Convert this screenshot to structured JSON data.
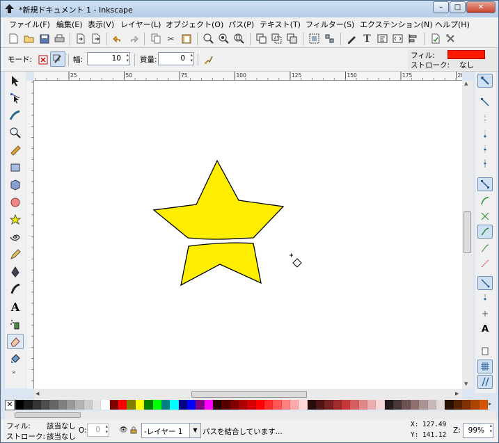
{
  "window": {
    "title": "*新規ドキュメント 1 - Inkscape",
    "minimize": "–",
    "maximize": "□",
    "close": "✕"
  },
  "menu": [
    "ファイル(F)",
    "編集(E)",
    "表示(V)",
    "レイヤー(L)",
    "オブジェクト(O)",
    "パス(P)",
    "テキスト(T)",
    "フィルター(S)",
    "エクステンション(N)",
    "ヘルプ(H)"
  ],
  "tool_controls": {
    "mode_label": "モード:",
    "width_label": "幅:",
    "width_value": "10",
    "mass_label": "質量:",
    "mass_value": "0"
  },
  "style_indicator": {
    "fill_label": "フィル:",
    "fill_color": "#ff1a00",
    "stroke_label": "ストローク:",
    "stroke_value": "なし"
  },
  "ruler": {
    "ticks": [
      "25",
      "50",
      "75",
      "100",
      "125",
      "150",
      "175",
      "200"
    ]
  },
  "canvas": {
    "star_fill": "#ffee00",
    "star_stroke": "#000000"
  },
  "palette": [
    "#000000",
    "#1a1a1a",
    "#333333",
    "#4d4d4d",
    "#666666",
    "#808080",
    "#999999",
    "#b3b3b3",
    "#cccccc",
    "#e6e6e6",
    "#ffffff",
    "#800000",
    "#ff0000",
    "#808000",
    "#ffff00",
    "#008000",
    "#00ff00",
    "#008080",
    "#00ffff",
    "#000080",
    "#0000ff",
    "#800080",
    "#ff00ff",
    "#2b0000",
    "#550000",
    "#800000",
    "#aa0000",
    "#d40000",
    "#ff0000",
    "#ff2a2a",
    "#ff5555",
    "#ff8080",
    "#ffaaaa",
    "#ffd5d5",
    "#280b0b",
    "#501616",
    "#782121",
    "#a02c2c",
    "#c83737",
    "#d35f5f",
    "#de8787",
    "#e9afaf",
    "#f4d7d7",
    "#241c1c",
    "#483737",
    "#6c5353",
    "#916f6f",
    "#ac9393",
    "#c8b7b7",
    "#e3dbdb",
    "#2b1100",
    "#552200",
    "#803300",
    "#aa4400",
    "#d45500"
  ],
  "status": {
    "fill_label": "フィル:",
    "fill_value": "該当なし",
    "stroke_label": "ストローク:",
    "stroke_value": "該当なし",
    "opacity_label": "O:",
    "opacity_value": "0",
    "layer": "-レイヤー 1",
    "message": "パスを結合しています...",
    "x_label": "X:",
    "x_value": "127.49",
    "y_label": "Y:",
    "y_value": "141.12",
    "zoom_label": "Z:",
    "zoom_value": "99%"
  }
}
